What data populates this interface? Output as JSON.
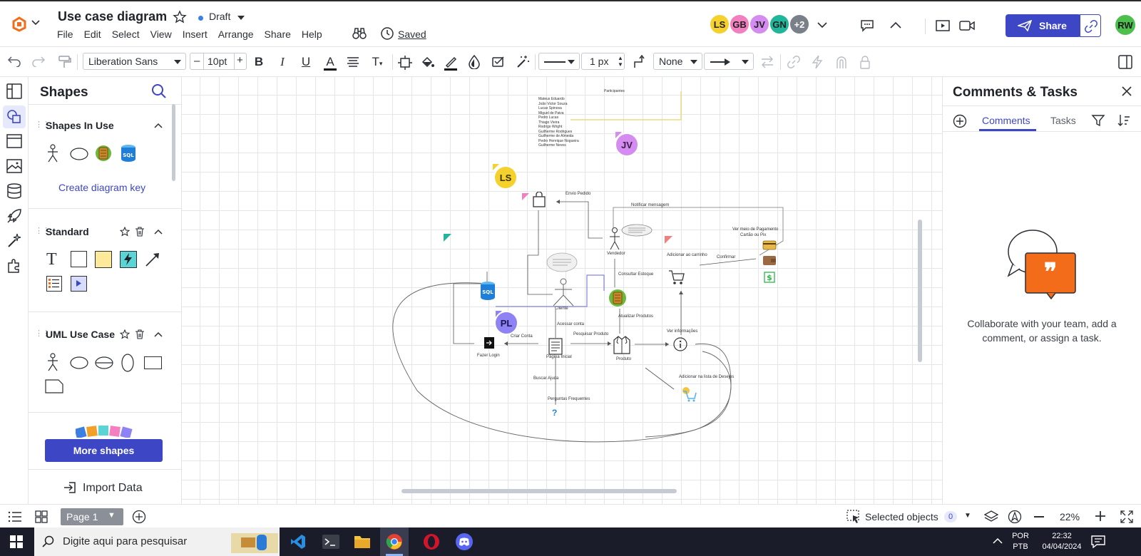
{
  "header": {
    "title": "Use case diagram",
    "status": "Draft",
    "saved": "Saved",
    "menu": [
      "File",
      "Edit",
      "Select",
      "View",
      "Insert",
      "Arrange",
      "Share",
      "Help"
    ],
    "avatars": [
      {
        "initials": "LS",
        "color": "#f5d12e"
      },
      {
        "initials": "GB",
        "color": "#f27fbf"
      },
      {
        "initials": "JV",
        "color": "#d58cf0"
      },
      {
        "initials": "GN",
        "color": "#21b59a"
      },
      {
        "initials": "+2",
        "color": "#7a8089"
      }
    ],
    "share_label": "Share",
    "user_initials": "RW"
  },
  "toolbar": {
    "font": "Liberation Sans",
    "font_size": "10pt",
    "line_width": "1 px",
    "arrow_start": "None"
  },
  "shapes_panel": {
    "title": "Shapes",
    "in_use_title": "Shapes In Use",
    "diagram_key_link": "Create diagram key",
    "standard_title": "Standard",
    "uml_title": "UML Use Case",
    "more_shapes": "More shapes",
    "import_data": "Import Data"
  },
  "comments_panel": {
    "title": "Comments & Tasks",
    "tabs": [
      "Comments",
      "Tasks"
    ],
    "empty_text": "Collaborate with your team, add a comment, or assign a task."
  },
  "bottom_bar": {
    "page_label": "Page 1",
    "selected_label": "Selected objects",
    "selected_count": "0",
    "zoom": "22%"
  },
  "taskbar": {
    "search_placeholder": "Digite aqui para pesquisar",
    "lang1": "POR",
    "lang2": "PTB",
    "time": "22:32",
    "date": "04/04/2024"
  },
  "canvas": {
    "cursors": [
      {
        "initials": "JV",
        "color": "#d58cf0"
      },
      {
        "initials": "LS",
        "color": "#f5d12e"
      },
      {
        "initials": "PL",
        "color": "#8f82f5"
      }
    ],
    "labels": {
      "envio": "Envio Pedido",
      "notificar": "Notificar mensagem",
      "vendedor": "Vendedor",
      "consultar": "Consultar Estoque",
      "cliente": "Cliente",
      "adicionar_carrinho": "Adicionar ao carrinho",
      "confirmar": "Confirmar",
      "ver_meio_pagamento": "Ver meio de Pagamento",
      "cartao_pix": "Cartão ou Pix",
      "atualizar_produtos": "Atualizar Produtos",
      "ver_informacoes": "Ver informações",
      "acessar_conta": "Acessar conta",
      "criar_conta": "Criar Conta",
      "fazer_login": "Fazer Login",
      "pesquisar_produto": "Pesquisar Produto",
      "pagina_inicial": "Página Inicial",
      "produto": "Produto",
      "buscar_ajuda": "Buscar Ajuda",
      "perguntas": "Perguntas Frequentes",
      "adicionar_lista": "Adicionar na lista de Desejos",
      "participantes": "Participantes",
      "team": [
        "Mateus Eduardo",
        "João Victor Souza",
        "Lucas Spinosa",
        "Miguel de Paiva",
        "Pedro Lucas",
        "Thiago Vieira",
        "Rodrigo Wright",
        "Guilherme Rodrigues",
        "Guilherme de Almeida",
        "Pedro Henrique Nogueira",
        "Guilherme Neves"
      ]
    }
  }
}
